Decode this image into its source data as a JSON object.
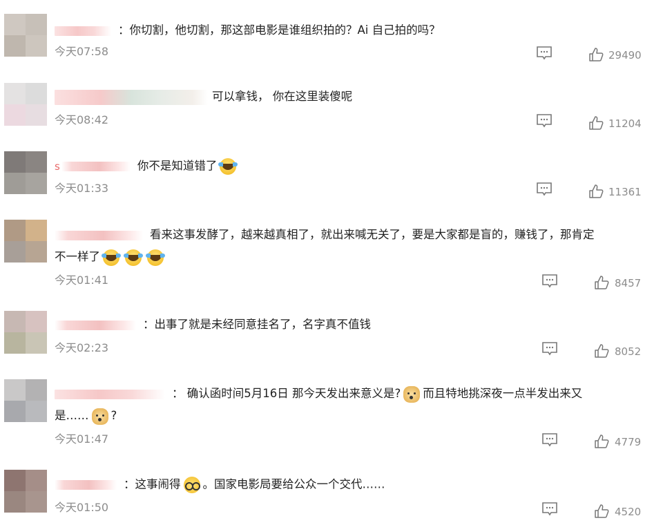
{
  "comments": [
    {
      "text_before": "：你切割，他切割，那这部电影是谁组织拍的？Ai 自己拍的吗？",
      "time": "今天07:58",
      "likes": "29490"
    },
    {
      "text_before": "可以拿钱， 你在这里装傻呢",
      "time": "今天08:42",
      "likes": "11204"
    },
    {
      "name_prefix": "s",
      "text_before": "你不是知道错了",
      "time": "今天01:33",
      "likes": "11361"
    },
    {
      "text_before": "看来这事发酵了，越来越真相了，就出来喊无关了，要是大家都是盲的，赚钱了，那肯定",
      "text_line2": "不一样了",
      "time": "今天01:41",
      "likes": "8457"
    },
    {
      "text_before": "：出事了就是未经同意挂名了，名字真不值钱",
      "time": "今天02:23",
      "likes": "8052"
    },
    {
      "text_before": "： 确认函时间5月16日 那今天发出来意义是?",
      "text_after": "而且特地挑深夜一点半发出来又",
      "text_line2": "是……",
      "text_line2_after": "?",
      "time": "今天01:47",
      "likes": "4779"
    },
    {
      "text_before": "：这事闹得",
      "text_after": "。国家电影局要给公众一个交代……",
      "time": "今天01:50",
      "likes": "4520"
    }
  ],
  "icons": {
    "reply": "comment-icon",
    "like": "thumbs-up-icon",
    "emoji_laugh": "laugh-cry-emoji",
    "emoji_doge": "doge-emoji",
    "emoji_glasses": "glasses-emoji"
  }
}
